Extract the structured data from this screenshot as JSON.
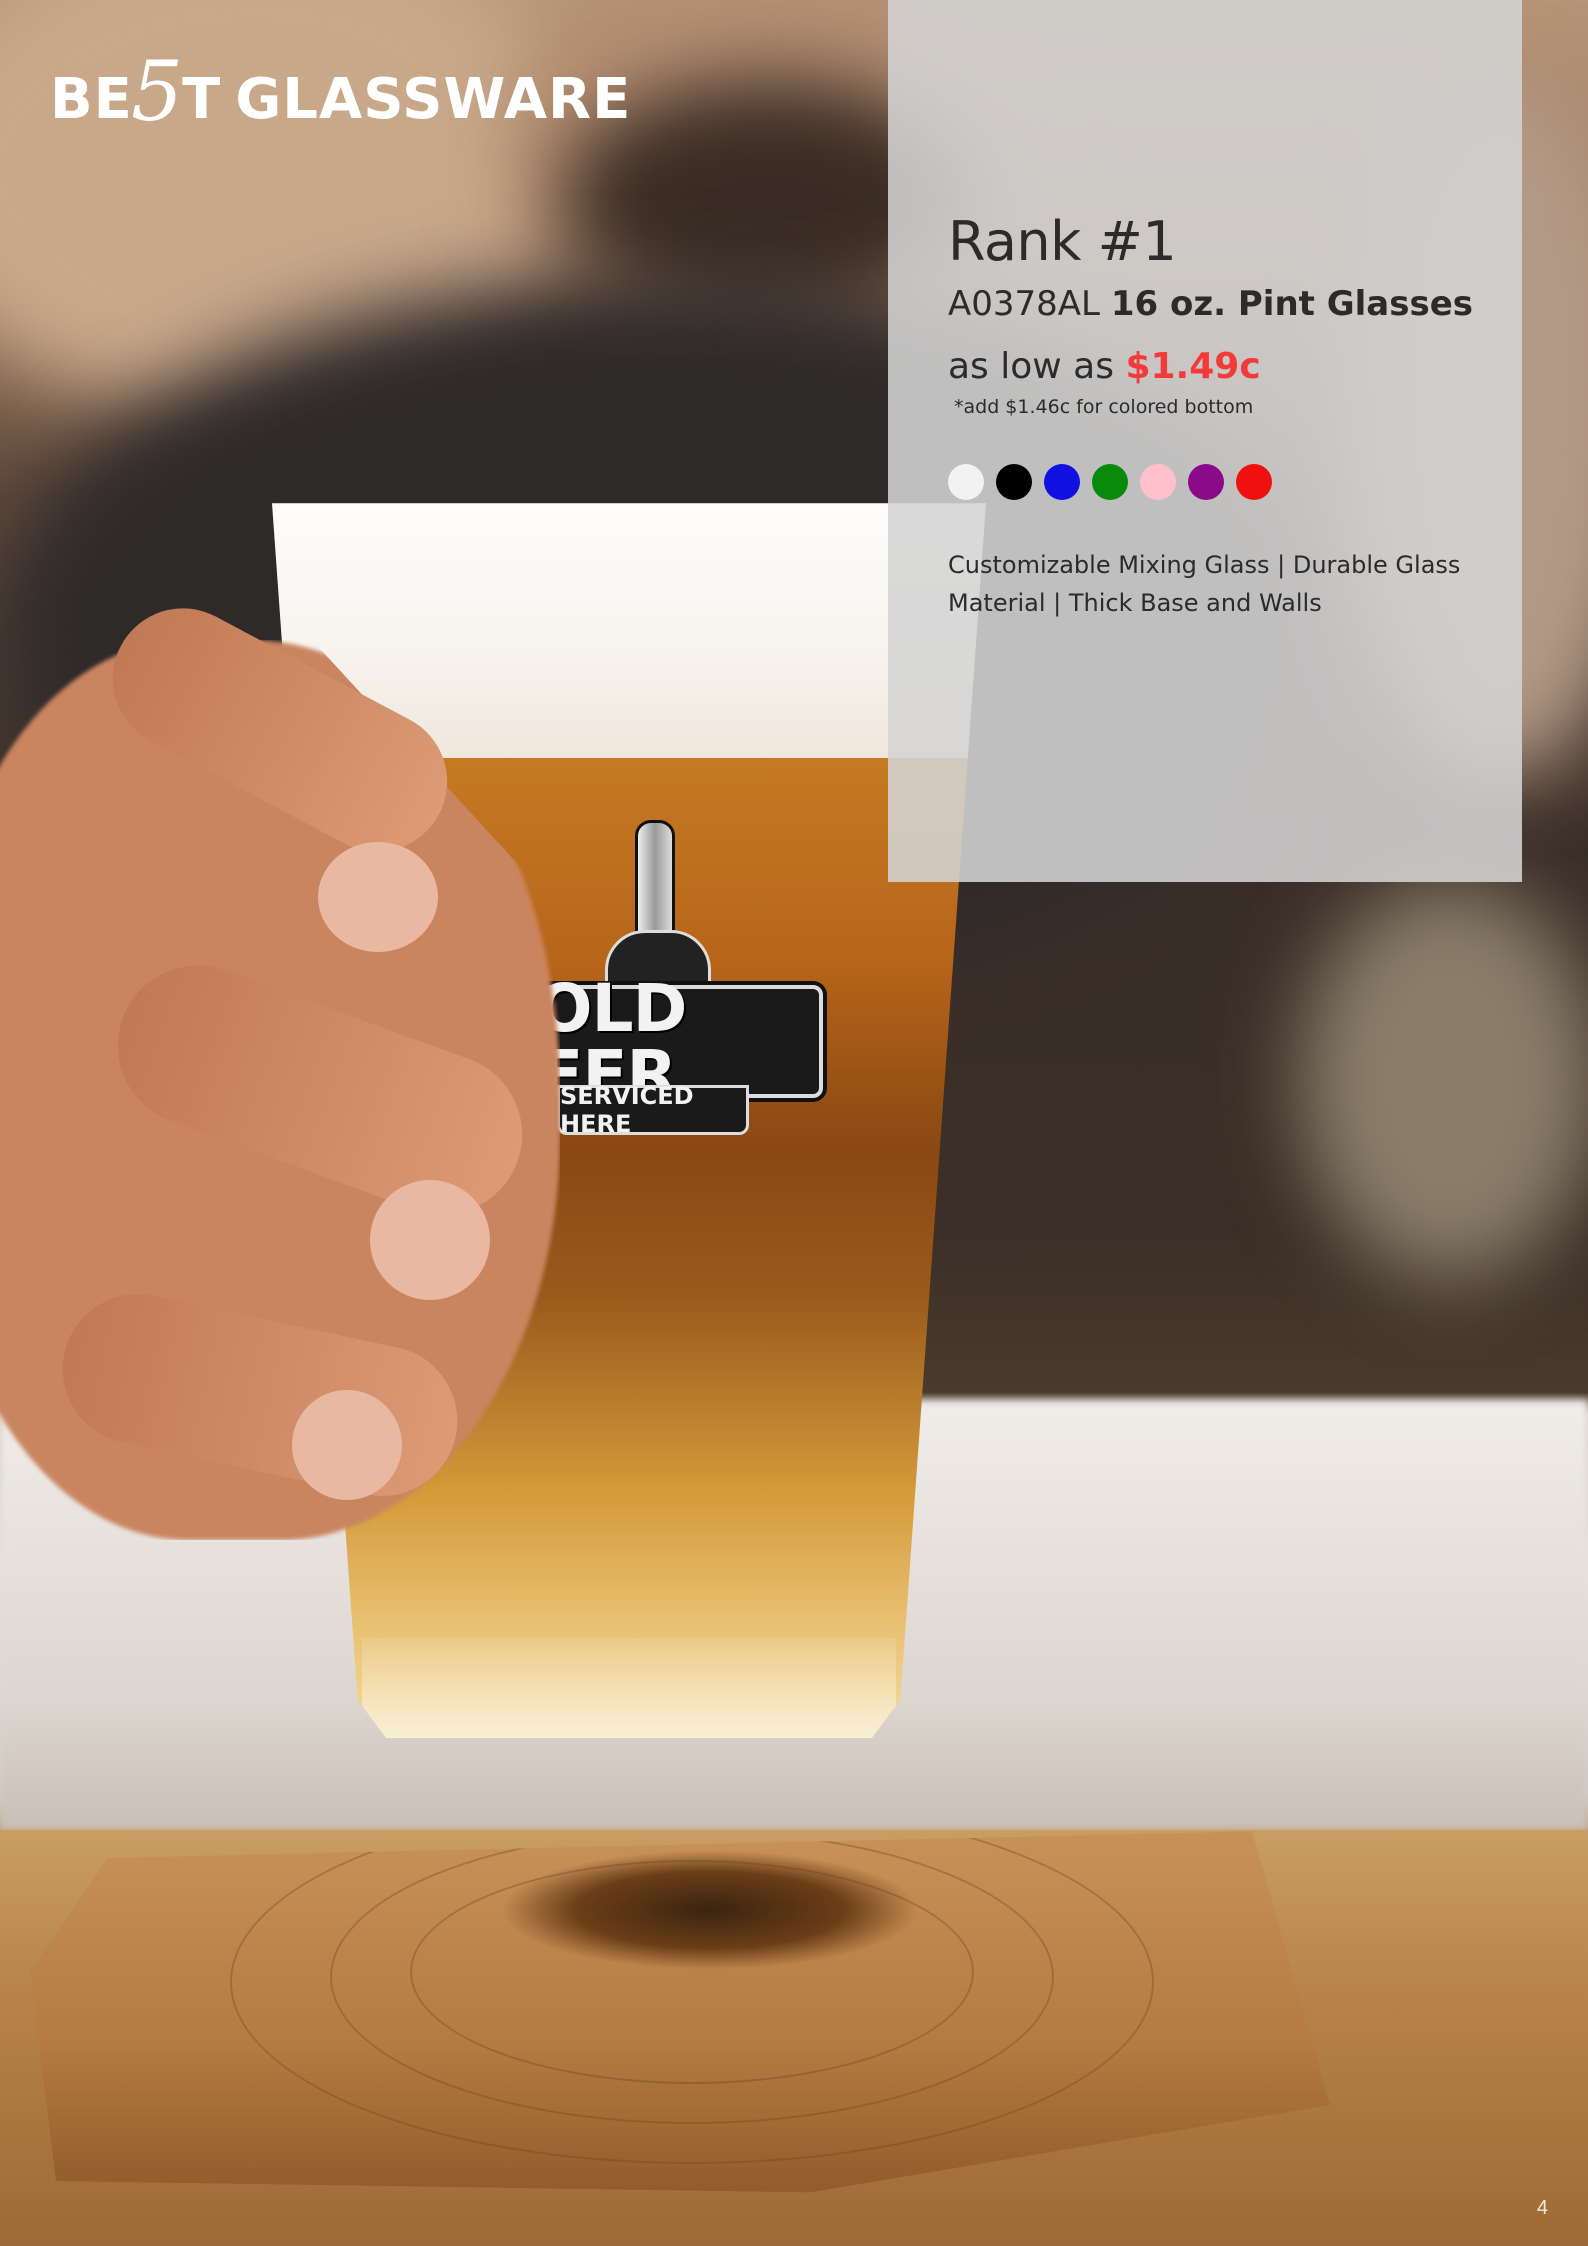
{
  "brand": {
    "part1": "BE",
    "part2": "5",
    "part3": "T",
    "part4": "GLASSWARE"
  },
  "product": {
    "rank": "Rank #1",
    "sku": "A0378AL",
    "name": "16 oz. Pint Glasses",
    "price_prefix": "as low as",
    "price": "$1.49c",
    "price_color": "#f23a3a",
    "note": "*add $1.46c for colored bottom",
    "colors": [
      "#f2f2f2",
      "#000000",
      "#1010e0",
      "#0a8a0a",
      "#ffc0cb",
      "#8a0a8a",
      "#f01010"
    ],
    "color_names": [
      "white",
      "black",
      "blue",
      "green",
      "pink",
      "purple",
      "red"
    ],
    "description": "Customizable Mixing Glass | Durable Glass Material | Thick Base and Walls"
  },
  "decal": {
    "main": "COLD BEER",
    "sub": "SERVICED HERE"
  },
  "page_number": "4"
}
